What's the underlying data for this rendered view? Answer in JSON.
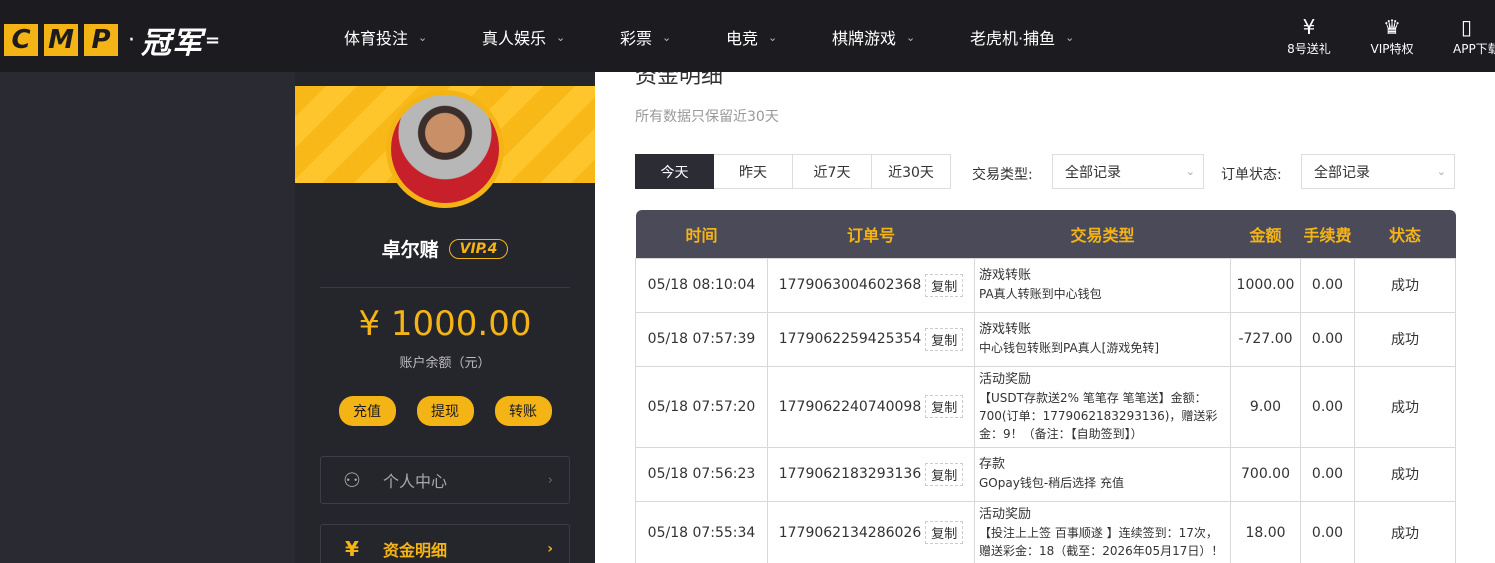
{
  "logo": {
    "letters": [
      "C",
      "M",
      "P"
    ],
    "dot": "·",
    "cn": "冠军",
    "tail": "="
  },
  "nav": [
    {
      "label": "体育投注"
    },
    {
      "label": "真人娱乐"
    },
    {
      "label": "彩票"
    },
    {
      "label": "电竞"
    },
    {
      "label": "棋牌游戏"
    },
    {
      "label": "老虎机·捕鱼"
    }
  ],
  "nav_caret": "⌄",
  "tools": [
    {
      "icon": "gift-ticket-icon",
      "glyph": "¥",
      "label": "8号送礼"
    },
    {
      "icon": "crown-icon",
      "glyph": "♛",
      "label": "VIP特权"
    },
    {
      "icon": "phone-icon",
      "glyph": "▯",
      "label": "APP下载"
    }
  ],
  "user": {
    "name": "卓尔赌",
    "vip": "VIP.4",
    "balance": "¥ 1000.00",
    "balance_label": "账户余额（元）",
    "actions": [
      "充值",
      "提现",
      "转账"
    ]
  },
  "sidebar_menu": [
    {
      "icon": "user-icon",
      "glyph": "⚇",
      "label": "个人中心",
      "arrow": "›"
    },
    {
      "icon": "yen-circle-icon",
      "glyph": "¥",
      "label": "资金明细",
      "arrow": "›"
    }
  ],
  "main": {
    "title": "资金明细",
    "subtitle": "所有数据只保留近30天",
    "tabs": [
      "今天",
      "昨天",
      "近7天",
      "近30天"
    ],
    "active_tab": "今天",
    "filters": {
      "type_label": "交易类型:",
      "type_value": "全部记录",
      "status_label": "订单状态:",
      "status_value": "全部记录",
      "chevron": "⌄"
    },
    "table": {
      "headers": [
        "时间",
        "订单号",
        "交易类型",
        "金额",
        "手续费",
        "状态"
      ],
      "copy_label": "复制",
      "rows": [
        {
          "time": "05/18 08:10:04",
          "order": "1779063004602368",
          "type_title": "游戏转账",
          "type_desc": "PA真人转账到中心钱包",
          "amount": "1000.00",
          "fee": "0.00",
          "status": "成功"
        },
        {
          "time": "05/18 07:57:39",
          "order": "1779062259425354",
          "type_title": "游戏转账",
          "type_desc": "中心钱包转账到PA真人[游戏免转]",
          "amount": "-727.00",
          "fee": "0.00",
          "status": "成功"
        },
        {
          "time": "05/18 07:57:20",
          "order": "1779062240740098",
          "type_title": "活动奖励",
          "type_desc": "【USDT存款送2% 笔笔存 笔笔送】金额：700(订单：1779062183293136)，赠送彩金：9！（备注：【自助签到】）",
          "amount": "9.00",
          "fee": "0.00",
          "status": "成功"
        },
        {
          "time": "05/18 07:56:23",
          "order": "1779062183293136",
          "type_title": "存款",
          "type_desc": "GOpay钱包-稍后选择 充值",
          "amount": "700.00",
          "fee": "0.00",
          "status": "成功"
        },
        {
          "time": "05/18 07:55:34",
          "order": "1779062134286026",
          "type_title": "活动奖励",
          "type_desc": "【投注上上签 百事顺遂 】连续签到：17次，赠送彩金：18（截至：2026年05月17日）！",
          "amount": "18.00",
          "fee": "0.00",
          "status": "成功"
        }
      ]
    }
  },
  "colors": {
    "accent": "#f5b415",
    "nav_bg": "#1b1b20",
    "sidebar_bg": "#25252c",
    "table_head": "#4a4a58",
    "success": "#3aa33a"
  }
}
